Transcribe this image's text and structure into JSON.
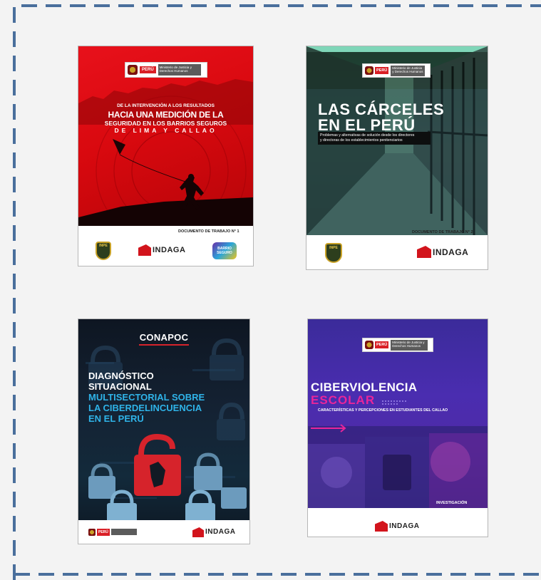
{
  "covers": [
    {
      "ministry": "Ministerio de Justicia y Derechos Humanos",
      "peru": "PERÚ",
      "kicker": "DE LA INTERVENCIÓN A LOS RESULTADOS",
      "title_line1": "HACIA UNA MEDICIÓN DE LA",
      "title_line2": "SEGURIDAD EN LOS BARRIOS SEGUROS",
      "title_line3": "DE LIMA Y CALLAO",
      "doc_label": "DOCUMENTO DE TRABAJO N° 1",
      "inpe": "INPE",
      "indaga": "INDAGA",
      "badge": "BARRIO SEGURO"
    },
    {
      "ministry": "Ministerio de Justicia y Derechos Humanos",
      "peru": "PERÚ",
      "title_line1": "LAS CÁRCELES",
      "title_line2": "EN EL PERÚ",
      "subtitle_line1": "Problemas y alternativas de solución desde los directores",
      "subtitle_line2": "y directoras de los establecimientos penitenciarios",
      "doc_label": "DOCUMENTO DE TRABAJO N° 2",
      "inpe": "INPE",
      "indaga": "INDAGA"
    },
    {
      "org": "CONAPOC",
      "title_line1": "DIAGNÓSTICO",
      "title_line2": "SITUACIONAL",
      "title_line3": "MULTISECTORIAL SOBRE",
      "title_line4": "LA CIBERDELINCUENCIA",
      "title_line5": "EN EL PERÚ",
      "peru": "PERÚ",
      "indaga": "INDAGA"
    },
    {
      "ministry": "Ministerio de Justicia y Derechos Humanos",
      "peru": "PERÚ",
      "title_line1": "CIBERVIOLENCIA",
      "title_line2": "ESCOLAR",
      "subtitle": "CARACTERÍSTICAS Y PERCEPCIONES EN ESTUDIANTES DEL CALLAO",
      "doc_label": "INVESTIGACIÓN",
      "indaga": "INDAGA"
    }
  ],
  "colors": {
    "frame_dash": "#4a6f9c",
    "panel_bg": "#f3f3f3",
    "red": "#e8111b",
    "cyan": "#2fb3e8",
    "magenta": "#e8259a"
  }
}
